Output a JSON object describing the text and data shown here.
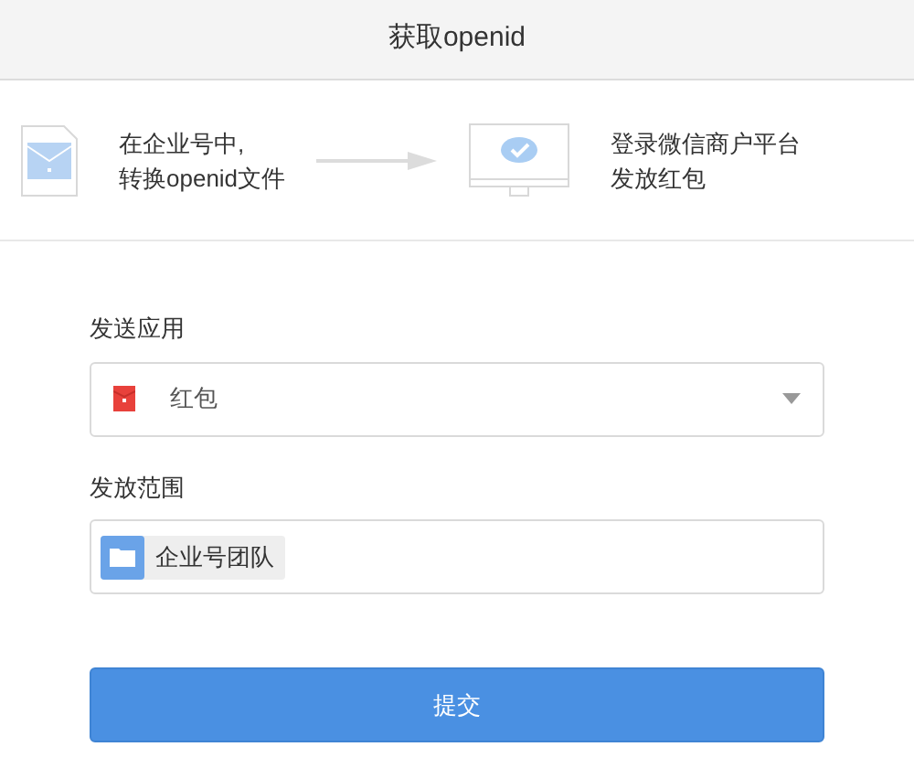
{
  "window": {
    "title": "获取openid"
  },
  "steps": [
    {
      "kind": "file",
      "lines": [
        "在企业号中,",
        "转换openid文件"
      ]
    },
    {
      "kind": "monitor",
      "lines": [
        "登录微信商户平台",
        "发放红包"
      ]
    }
  ],
  "fields": [
    {
      "kind": "select",
      "label": "发送应用",
      "value": "红包"
    },
    {
      "kind": "tags",
      "label": "发放范围",
      "tags": [
        "企业号团队"
      ]
    }
  ],
  "submit": "提交"
}
